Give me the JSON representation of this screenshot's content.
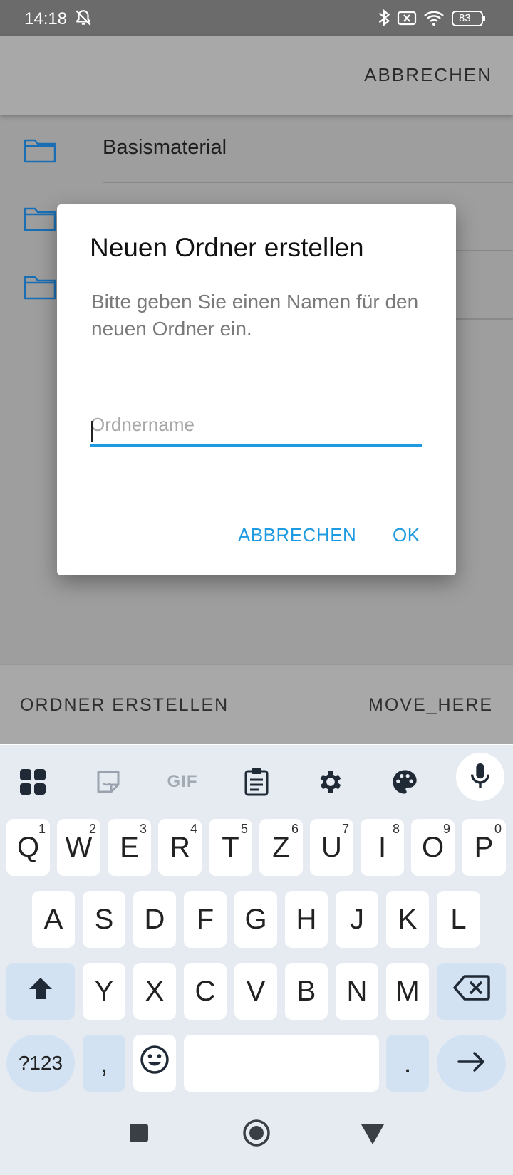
{
  "status_bar": {
    "time": "14:18",
    "battery": "83",
    "icons": [
      "bell-off-icon",
      "bluetooth-icon",
      "sim-off-icon",
      "wifi-icon",
      "battery-icon"
    ]
  },
  "header": {
    "cancel_label": "ABBRECHEN"
  },
  "folders": [
    {
      "label": "Basismaterial",
      "icon": "folder-icon"
    },
    {
      "label": "",
      "icon": "folder-icon"
    },
    {
      "label": "",
      "icon": "folder-icon"
    }
  ],
  "footer": {
    "create_folder_label": "ORDNER ERSTELLEN",
    "move_here_label": "MOVE_HERE"
  },
  "dialog": {
    "title": "Neuen Ordner erstellen",
    "message": "Bitte geben Sie einen Namen für den neuen Ordner ein.",
    "input_placeholder": "Ordnername",
    "input_value": "",
    "cancel_label": "ABBRECHEN",
    "ok_label": "OK"
  },
  "keyboard": {
    "toolbar": [
      "apps-icon",
      "sticker-icon",
      "gif-icon",
      "clipboard-icon",
      "settings-icon",
      "palette-icon",
      "microphone-icon"
    ],
    "gif_label": "GIF",
    "row1": [
      {
        "key": "Q",
        "sup": "1"
      },
      {
        "key": "W",
        "sup": "2"
      },
      {
        "key": "E",
        "sup": "3"
      },
      {
        "key": "R",
        "sup": "4"
      },
      {
        "key": "T",
        "sup": "5"
      },
      {
        "key": "Z",
        "sup": "6"
      },
      {
        "key": "U",
        "sup": "7"
      },
      {
        "key": "I",
        "sup": "8"
      },
      {
        "key": "O",
        "sup": "9"
      },
      {
        "key": "P",
        "sup": "0"
      }
    ],
    "row2": [
      "A",
      "S",
      "D",
      "F",
      "G",
      "H",
      "J",
      "K",
      "L"
    ],
    "row3": [
      "Y",
      "X",
      "C",
      "V",
      "B",
      "N",
      "M"
    ],
    "symbols_label": "?123",
    "comma_label": ",",
    "period_label": ".",
    "accent_color": "#d3e2f3"
  },
  "colors": {
    "accent": "#1e9be0",
    "folder_icon": "#1a6fb4",
    "scrim": "#9e9e9e"
  }
}
